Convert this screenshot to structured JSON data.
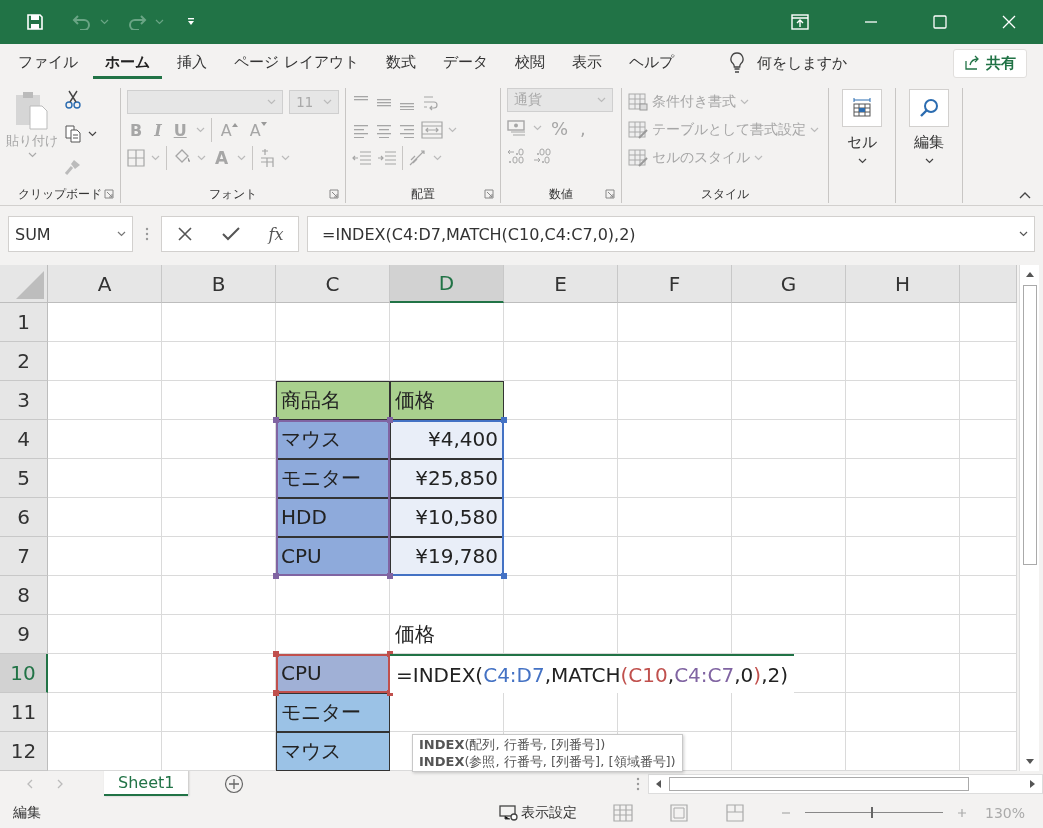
{
  "ribbon_tabs": [
    {
      "label": "ファイル",
      "selected": false
    },
    {
      "label": "ホーム",
      "selected": true
    },
    {
      "label": "挿入",
      "selected": false
    },
    {
      "label": "ページ レイアウト",
      "selected": false
    },
    {
      "label": "数式",
      "selected": false
    },
    {
      "label": "データ",
      "selected": false
    },
    {
      "label": "校閲",
      "selected": false
    },
    {
      "label": "表示",
      "selected": false
    },
    {
      "label": "ヘルプ",
      "selected": false
    }
  ],
  "tell_me": "何をしますか",
  "share_button": "共有",
  "ribbon": {
    "clipboard": {
      "label": "クリップボード",
      "paste": {
        "label": "貼り付け",
        "disabled": true
      }
    },
    "font": {
      "label": "フォント",
      "disabled": true,
      "size": "11",
      "style_buttons": [
        {
          "text": "B",
          "kind": "bold"
        },
        {
          "text": "I",
          "kind": "italic"
        },
        {
          "text": "U",
          "kind": "underline"
        }
      ],
      "size_buttons": [
        {
          "text": "A",
          "kind": "grow"
        },
        {
          "text": "A",
          "kind": "shrink"
        }
      ],
      "color_button": "A"
    },
    "alignment": {
      "label": "配置",
      "disabled": true
    },
    "number": {
      "label": "数値",
      "disabled": true,
      "format": "通貨",
      "symbols": [
        "%",
        ","
      ]
    },
    "styles": {
      "label": "スタイル",
      "items": [
        {
          "label": "条件付き書式",
          "disabled": true
        },
        {
          "label": "テーブルとして書式設定",
          "disabled": true
        },
        {
          "label": "セルのスタイル",
          "disabled": true
        }
      ]
    },
    "cells": {
      "label": "セル"
    },
    "editing": {
      "label": "編集"
    }
  },
  "formula_bar": {
    "name_box": "SUM",
    "function_button": "fx",
    "formula": "=INDEX(C4:D7,MATCH(C10,C4:C7,0),2)"
  },
  "sheet": {
    "columns": [
      {
        "label": "A",
        "selected": false
      },
      {
        "label": "B",
        "selected": false
      },
      {
        "label": "C",
        "selected": false
      },
      {
        "label": "D",
        "selected": true
      },
      {
        "label": "E",
        "selected": false
      },
      {
        "label": "F",
        "selected": false
      },
      {
        "label": "G",
        "selected": false
      },
      {
        "label": "H",
        "selected": false
      }
    ],
    "rows": [
      {
        "label": "1",
        "selected": false,
        "cells": [
          null,
          null,
          null,
          null,
          null,
          null,
          null,
          null
        ]
      },
      {
        "label": "2",
        "selected": false,
        "cells": [
          null,
          null,
          null,
          null,
          null,
          null,
          null,
          null
        ]
      },
      {
        "label": "3",
        "selected": false,
        "cells": [
          null,
          null,
          {
            "kind": "text",
            "text": "商品名",
            "color": "#a9d08e",
            "bordered": true
          },
          {
            "kind": "text",
            "text": "価格",
            "color": "#a9d08e",
            "bordered": true
          },
          null,
          null,
          null,
          null
        ]
      },
      {
        "label": "4",
        "selected": false,
        "cells": [
          null,
          null,
          {
            "kind": "text",
            "text": "マウス",
            "color": "#8eaadb",
            "bordered": true
          },
          {
            "kind": "number",
            "text": "¥4,400",
            "color": "#e9eef8",
            "bordered": true
          },
          null,
          null,
          null,
          null
        ]
      },
      {
        "label": "5",
        "selected": false,
        "cells": [
          null,
          null,
          {
            "kind": "text",
            "text": "モニター",
            "color": "#8eaadb",
            "bordered": true
          },
          {
            "kind": "number",
            "text": "¥25,850",
            "color": "#e9eef8",
            "bordered": true
          },
          null,
          null,
          null,
          null
        ]
      },
      {
        "label": "6",
        "selected": false,
        "cells": [
          null,
          null,
          {
            "kind": "text",
            "text": "HDD",
            "color": "#8eaadb",
            "bordered": true
          },
          {
            "kind": "number",
            "text": "¥10,580",
            "color": "#e9eef8",
            "bordered": true
          },
          null,
          null,
          null,
          null
        ]
      },
      {
        "label": "7",
        "selected": false,
        "cells": [
          null,
          null,
          {
            "kind": "text",
            "text": "CPU",
            "color": "#8eaadb",
            "bordered": true
          },
          {
            "kind": "number",
            "text": "¥19,780",
            "color": "#e9eef8",
            "bordered": true
          },
          null,
          null,
          null,
          null
        ]
      },
      {
        "label": "8",
        "selected": false,
        "cells": [
          null,
          null,
          null,
          null,
          null,
          null,
          null,
          null
        ]
      },
      {
        "label": "9",
        "selected": false,
        "cells": [
          null,
          null,
          null,
          {
            "kind": "text",
            "text": "価格"
          },
          null,
          null,
          null,
          null
        ]
      },
      {
        "label": "10",
        "selected": true,
        "cells": [
          null,
          null,
          {
            "kind": "text",
            "text": "CPU",
            "color": "#a0b0d6",
            "bordered": true
          },
          {
            "kind": "editing",
            "parts": [
              {
                "text": "=INDEX("
              },
              {
                "text": "C4:D7",
                "color": "#4472c4"
              },
              {
                "text": ",MATCH"
              },
              {
                "text": "(",
                "color": "#c0504d"
              },
              {
                "text": "C10",
                "color": "#c0504d"
              },
              {
                "text": ","
              },
              {
                "text": "C4:C7",
                "color": "#8064a2"
              },
              {
                "text": ",0"
              },
              {
                "text": ")",
                "color": "#c0504d"
              },
              {
                "text": ",2)"
              }
            ]
          },
          null,
          null,
          null,
          null
        ]
      },
      {
        "label": "11",
        "selected": false,
        "cells": [
          null,
          null,
          {
            "kind": "text",
            "text": "モニター",
            "color": "#9bc2e6",
            "bordered": true
          },
          null,
          null,
          null,
          null,
          null
        ]
      },
      {
        "label": "12",
        "selected": false,
        "cells": [
          null,
          null,
          {
            "kind": "text",
            "text": "マウス",
            "color": "#9bc2e6",
            "bordered": true
          },
          null,
          null,
          null,
          null,
          null
        ]
      }
    ],
    "function_tooltip": [
      "**INDEX**(配列, 行番号, [列番号])",
      "**INDEX**(参照, 行番号, [列番号], [領域番号])"
    ]
  },
  "sheet_tabs": [
    {
      "label": "Sheet1",
      "selected": true
    }
  ],
  "status_bar": {
    "mode": "編集",
    "display_settings": "表示設定",
    "zoom": "130%",
    "zoom_slider": {
      "level": 0.48
    }
  }
}
